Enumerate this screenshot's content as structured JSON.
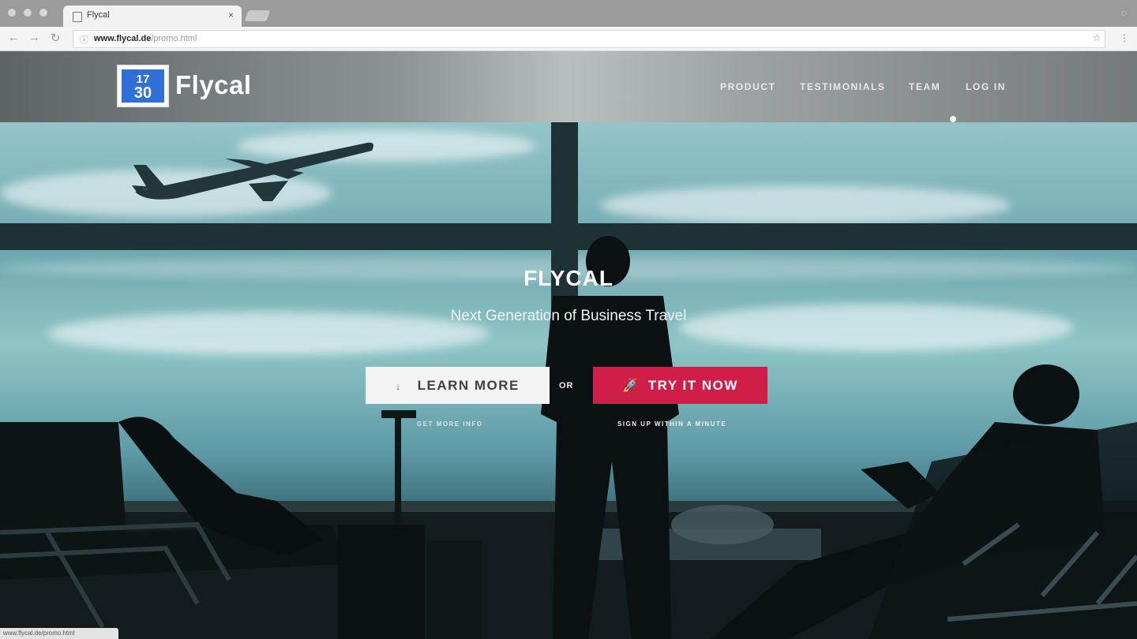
{
  "browser": {
    "tab_title": "Flycal",
    "tab_close": "×",
    "back": "←",
    "forward": "→",
    "reload": "↻",
    "info_icon": "ⓘ",
    "url_host": "www.flycal.de",
    "url_path": "/promo.html",
    "star": "☆",
    "menu": "⋮",
    "window_controls": "○"
  },
  "site": {
    "logo_top": "17",
    "logo_bottom": "30",
    "brand": "Flycal",
    "nav": [
      "PRODUCT",
      "TESTIMONIALS",
      "TEAM",
      "LOG IN"
    ]
  },
  "hero": {
    "title": "FLYCAL",
    "subtitle": "Next Generation of Business Travel",
    "learn_icon": "↓",
    "learn_label": "LEARN MORE",
    "or": "OR",
    "try_icon": "🚀",
    "try_label": "TRY IT NOW",
    "learn_sub": "GET MORE INFO",
    "try_sub": "SIGN UP WITHIN A MINUTE"
  },
  "status_bar": "www.flycal.de/promo.html",
  "colors": {
    "accent": "#cf1f48",
    "logo_blue": "#2f6fd8"
  }
}
